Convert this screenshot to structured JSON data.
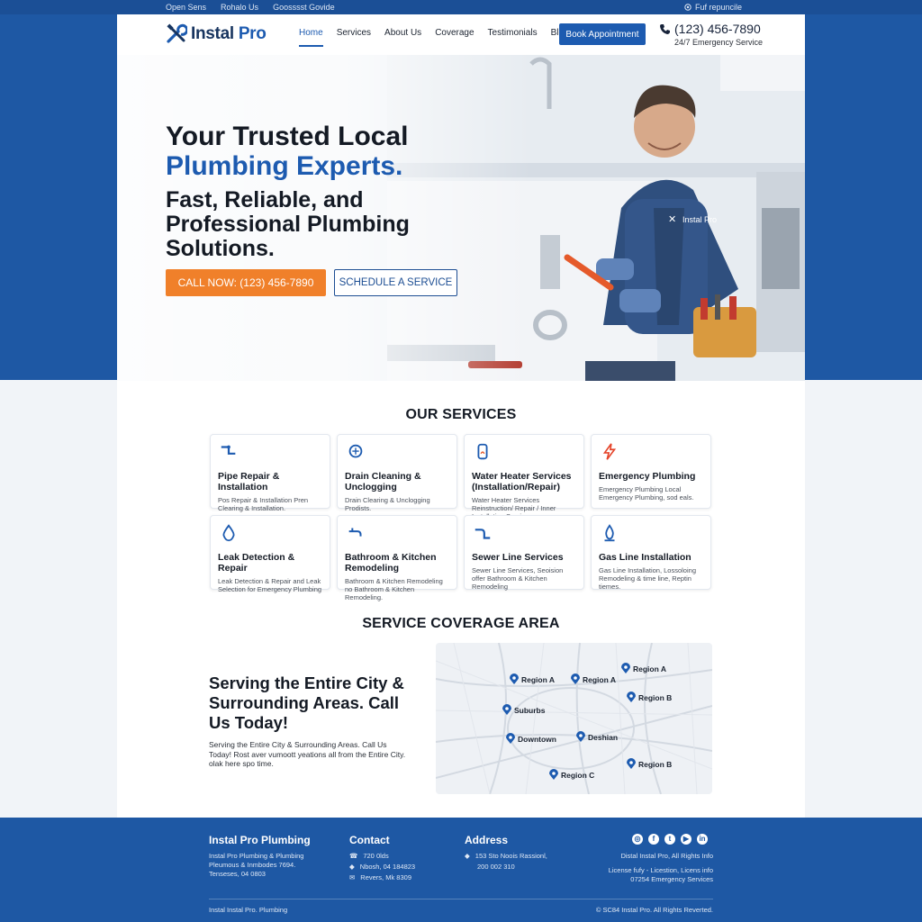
{
  "topbar": {
    "items": [
      "Open Sens",
      "Rohalo Us",
      "Goosssst Govide"
    ],
    "right": "Fuf repuncile"
  },
  "header": {
    "logo_word": "Instal",
    "logo_pro": "Pro",
    "nav": [
      "Home",
      "Services",
      "About Us",
      "Coverage",
      "Testimonials",
      "Blog"
    ],
    "book_label": "Book Appointment",
    "phone": "(123) 456-7890",
    "phone_sub": "24/7 Emergency Service"
  },
  "hero": {
    "title_line1": "Your Trusted Local",
    "title_line2": "Plumbing Experts.",
    "subtitle": "Fast, Reliable, and Professional Plumbing Solutions.",
    "call_label": "CALL NOW: (123) 456-7890",
    "schedule_label": "SCHEDULE A SERVICE",
    "shirt_logo": "Instal Pro"
  },
  "services": {
    "title": "OUR SERVICES",
    "cards": [
      {
        "title": "Pipe Repair & Installation",
        "desc": "Pos Repair & Installation Pren Clearing & Installation.",
        "icon": "pipe-icon"
      },
      {
        "title": "Drain Cleaning & Unclogging",
        "desc": "Drain Clearing & Unclogging Prodists.",
        "icon": "drain-icon"
      },
      {
        "title": "Water Heater Services (Installation/Repair)",
        "desc": "Water Heater Services Reinstruction/ Repair / Inner Installation Services.",
        "icon": "water-heater-icon"
      },
      {
        "title": "Emergency Plumbing",
        "desc": "Emergency Plumbing Local Emergency Plumbing, sod eals.",
        "icon": "lightning-icon"
      },
      {
        "title": "Leak Detection & Repair",
        "desc": "Leak Detection & Repair and Leak Selection for Emergency Plumbing",
        "icon": "droplet-icon"
      },
      {
        "title": "Bathroom & Kitchen Remodeling",
        "desc": "Bathroom & Kitchen Remodeling no Bathroom & Kitchen Remodeling.",
        "icon": "faucet-icon"
      },
      {
        "title": "Sewer Line Services",
        "desc": "Sewer Line Services, Seoision offer Bathroom & Kitchen Remodeling",
        "icon": "sewer-pipe-icon"
      },
      {
        "title": "Gas Line Installation",
        "desc": "Gas Line Installation, Lossoloing Remodeling & time line, Reptin tiemes.",
        "icon": "gas-flame-icon"
      }
    ]
  },
  "coverage": {
    "section_title": "SERVICE COVERAGE AREA",
    "heading": "Serving the Entire City & Surrounding Areas. Call Us Today!",
    "desc": "Serving the Entire City & Surrounding Areas. Call Us Today! Rost aver vumoott yeations all from the Entire City. olak here spo time.",
    "map_labels": [
      "Region A",
      "Region A",
      "Region A",
      "Region B",
      "Suburbs",
      "Downtown",
      "Deshian",
      "Region B",
      "Region C"
    ]
  },
  "footer": {
    "brand": "Instal Pro Plumbing",
    "brand_desc": "Instal Pro Plumbing & Plumbing Pleumous & Inmbodes 7694. Tenseses, 04 0803",
    "contact_title": "Contact",
    "contact_lines": [
      "720 0lds",
      "Nbosh, 04 184823",
      "Revers, Mk 8309"
    ],
    "address_title": "Address",
    "address_lines": [
      "153 Sto Noois Rassionl,",
      "200 002 310"
    ],
    "social_line": "Distal Instal Pro, All Rights Info",
    "license": "License fufy - Licestion, Licens info 07254 Emergency Services",
    "bottom_left": "Instal Instal Pro. Plumbing",
    "bottom_right": "© SC84 Instal Pro. All Rights Reverted."
  }
}
